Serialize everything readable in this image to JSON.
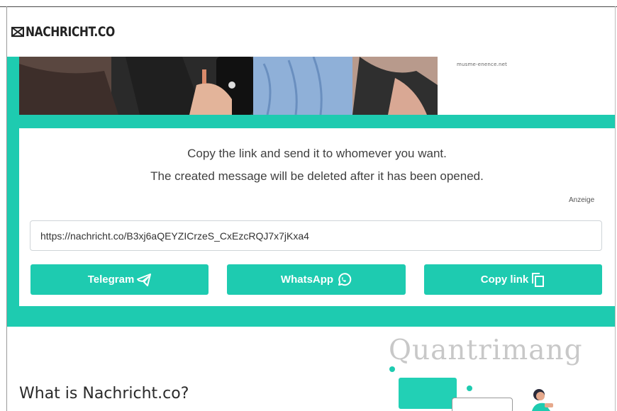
{
  "header": {
    "logo_text": "NACHRICHT.CO",
    "logo_icon": "envelope-icon"
  },
  "ad": {
    "domain": "musme-enence.net",
    "label": "Anzeige"
  },
  "share": {
    "instruction_line1": "Copy the link and send it to whomever you want.",
    "instruction_line2": "The created message will be deleted after it has been opened.",
    "link_value": "https://nachricht.co/B3xj6aQEYZICrzeS_CxEzcRQJ7x7jKxa4",
    "buttons": {
      "telegram": "Telegram",
      "whatsapp": "WhatsApp",
      "copy": "Copy link"
    }
  },
  "about": {
    "heading": "What is Nachricht.co?"
  },
  "watermark": {
    "text": "Quantrimang"
  },
  "colors": {
    "accent": "#1ecbb0",
    "text": "#404040"
  }
}
